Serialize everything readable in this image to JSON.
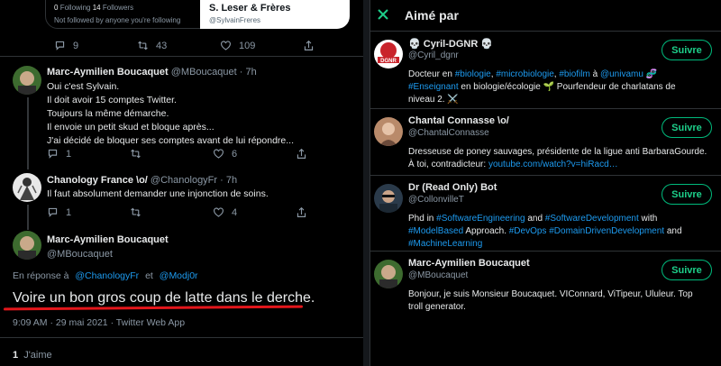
{
  "embed": {
    "following_count": "0",
    "following_label": "Following",
    "followers_count": "14",
    "followers_label": "Followers",
    "not_followed": "Not followed by anyone you're following",
    "card_name": "S. Leser & Frères",
    "card_handle": "@SylvainFreres"
  },
  "top_actions": {
    "replies": "9",
    "retweets": "43",
    "likes": "109"
  },
  "tweets": [
    {
      "name": "Marc-Aymilien Boucaquet",
      "handle_time": "@MBoucaquet · 7h",
      "lines": [
        "Oui c'est Sylvain.",
        "Il doit avoir 15 comptes Twitter.",
        "Toujours la même démarche.",
        "Il envoie un petit skud et bloque après...",
        "J'ai décidé de bloquer ses comptes avant de lui répondre..."
      ],
      "replies": "1",
      "likes": "6"
    },
    {
      "name": "Chanology France \\o/",
      "handle_time": "@ChanologyFr · 7h",
      "lines": [
        "Il faut absolument demander une injonction de soins."
      ],
      "replies": "1",
      "likes": "4"
    }
  ],
  "main_tweet": {
    "name": "Marc-Aymilien Boucaquet",
    "handle": "@MBoucaquet",
    "reply_prefix": "En réponse à",
    "reply_to_1": "@ChanologyFr",
    "reply_and": "et",
    "reply_to_2": "@Modj0r",
    "text": "Voire un bon gros coup de latte dans le derche.",
    "meta": "9:09 AM · 29 mai 2021 · Twitter Web App",
    "like_count": "1",
    "like_label": "J'aime"
  },
  "liked_by": {
    "title": "Aimé par",
    "follow_label": "Suivre",
    "users": [
      {
        "name": "💀 Cyril-DGNR 💀",
        "handle": "@Cyril_dgnr",
        "avatar_text": "DGNR",
        "bio_lines": [
          [
            [
              "Docteur en ",
              false
            ],
            [
              "#biologie",
              true
            ],
            [
              ", ",
              false
            ],
            [
              "#microbiologie",
              true
            ],
            [
              ", ",
              false
            ],
            [
              "#biofilm",
              true
            ],
            [
              " à ",
              false
            ],
            [
              "@univamu",
              true
            ],
            [
              " 🧬",
              false
            ]
          ],
          [
            [
              "#Enseignant",
              true
            ],
            [
              " en biologie/écologie 🌱 Pourfendeur de charlatans de",
              false
            ]
          ],
          [
            [
              "niveau 2. ⚔️",
              false
            ]
          ]
        ]
      },
      {
        "name": "Chantal Connasse \\o/",
        "handle": "@ChantalConnasse",
        "bio_lines": [
          [
            [
              "Dresseuse de poney sauvages, présidente de la ligue anti BarbaraGourde.",
              false
            ]
          ],
          [
            [
              "À toi, contradicteur: ",
              false
            ],
            [
              "youtube.com/watch?v=hiRacd…",
              true
            ]
          ]
        ]
      },
      {
        "name": "Dr (Read Only) Bot",
        "handle": "@CollonvilleT",
        "bio_lines": [
          [
            [
              "Phd in ",
              false
            ],
            [
              "#SoftwareEngineering",
              true
            ],
            [
              " and ",
              false
            ],
            [
              "#SoftwareDevelopment",
              true
            ],
            [
              " with",
              false
            ]
          ],
          [
            [
              "#ModelBased",
              true
            ],
            [
              " Approach. ",
              false
            ],
            [
              "#DevOps",
              true
            ],
            [
              " ",
              false
            ],
            [
              "#DomainDrivenDevelopment",
              true
            ],
            [
              " and",
              false
            ]
          ],
          [
            [
              "#MachineLearning",
              true
            ]
          ]
        ]
      },
      {
        "name": "Marc-Aymilien Boucaquet",
        "handle": "@MBoucaquet",
        "bio_lines": [
          [
            [
              "Bonjour, je suis Monsieur Boucaquet. VIConnard, ViTipeur, Ululeur. Top",
              false
            ]
          ],
          [
            [
              "troll generator.",
              false
            ]
          ]
        ]
      }
    ]
  },
  "colors": {
    "accent": "#1d9bf0",
    "follow_green": "#00ba7c",
    "underline_red": "#e3161b",
    "background": "#000000"
  }
}
